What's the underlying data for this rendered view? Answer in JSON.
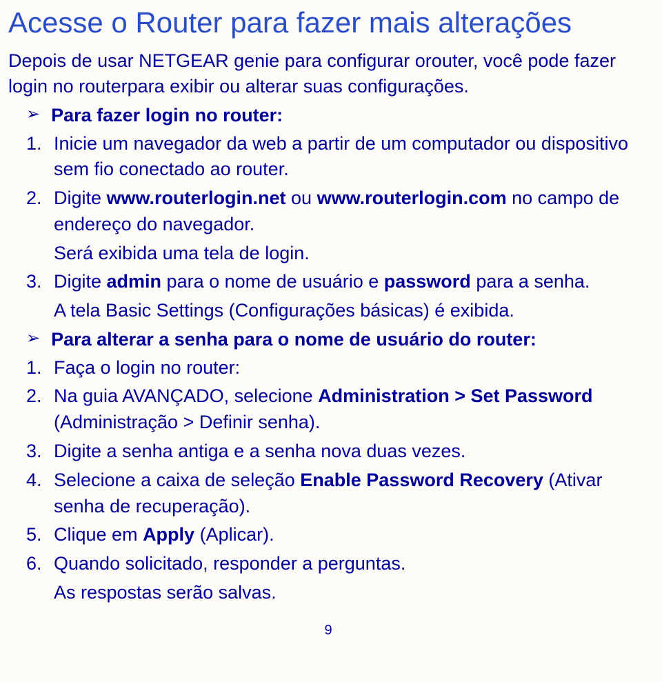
{
  "title": "Acesse o Router para fazer mais alterações",
  "intro": "Depois de usar NETGEAR genie para configurar orouter, você pode fazer login no routerpara exibir ou alterar suas configurações.",
  "section1": {
    "heading": "Para fazer login no router:",
    "step1": "Inicie um navegador da web a partir de um computador ou dispositivo sem fio conectado ao router.",
    "step2_a": "Digite ",
    "step2_b": "www.routerlogin.net",
    "step2_c": " ou ",
    "step2_d": "www.routerlogin.com",
    "step2_e": " no campo de endereço do navegador.",
    "step2_sub": "Será exibida uma tela de login.",
    "step3_a": "Digite ",
    "step3_b": "admin",
    "step3_c": " para o nome de usuário e ",
    "step3_d": "password",
    "step3_e": " para a senha.",
    "step3_sub": "A tela Basic Settings (Configurações básicas) é exibida."
  },
  "section2": {
    "heading": "Para alterar a senha para o nome de usuário do router:",
    "step1": "Faça o login no router:",
    "step2_a": "Na guia AVANÇADO, selecione ",
    "step2_b": "Administration > Set Password",
    "step2_c": " (Administração > Definir senha).",
    "step3": "Digite a senha antiga e a senha nova duas vezes.",
    "step4_a": "Selecione a caixa de seleção ",
    "step4_b": "Enable Password Recovery",
    "step4_c": " (Ativar senha de recuperação).",
    "step5_a": "Clique em ",
    "step5_b": "Apply",
    "step5_c": " (Aplicar).",
    "step6": "Quando solicitado, responder a perguntas.",
    "step6_sub": "As respostas serão salvas."
  },
  "page_number": "9"
}
